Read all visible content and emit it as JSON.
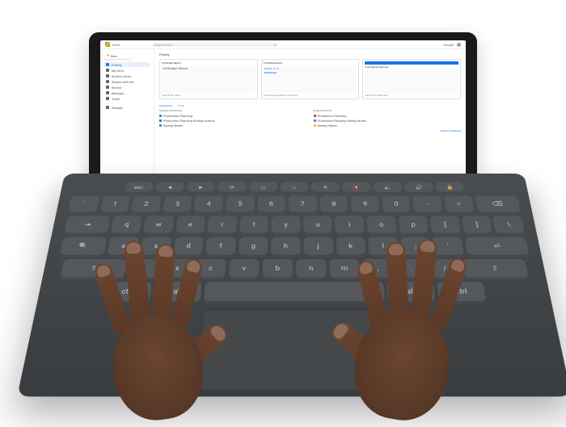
{
  "app": {
    "name": "Drive",
    "brand": "Google"
  },
  "search": {
    "placeholder": "Search Drive"
  },
  "sidebar": {
    "new_label": "New",
    "items": [
      {
        "label": "Priority"
      },
      {
        "label": "My Drive"
      },
      {
        "label": "Shared drives"
      },
      {
        "label": "Shared with me"
      },
      {
        "label": "Recent"
      },
      {
        "label": "Backups"
      },
      {
        "label": "Trash"
      }
    ],
    "storage": "Storage"
  },
  "priority": {
    "heading": "Priority",
    "cards": [
      {
        "title": "Q3 Budget Report",
        "subtitle": "Q3 Budget Report",
        "footer_name": "Laura Pronto",
        "footer_note": "Edited"
      },
      {
        "title": "Q3 Budget Report",
        "subtitle_small": "SLIDES 11-13",
        "subtitle": "Final Decks",
        "footer_note": "Leah Hoegan requested an action item"
      },
      {
        "title": "Volunteering Sign-ups",
        "footer_note": "Alex Simons edited today"
      }
    ]
  },
  "workspaces": {
    "tabs": [
      "Workspaces",
      "Create"
    ],
    "columns": [
      {
        "header": "Anderson-Production",
        "files": [
          {
            "name": "Production Planning",
            "icon": "blue"
          },
          {
            "name": "Production Planning Rolling Actions",
            "icon": "green"
          },
          {
            "name": "Weekly Notes",
            "icon": "blue"
          }
        ]
      },
      {
        "header": "Project Financial",
        "files": [
          {
            "name": "Production Planning",
            "icon": "red"
          },
          {
            "name": "Production Planning Rolling Notes",
            "icon": "blue"
          },
          {
            "name": "Weekly Notes",
            "icon": "yellow"
          }
        ]
      }
    ],
    "more": "Create a workspace"
  },
  "keyboard": {
    "fn_row": [
      "esc",
      "◄",
      "►",
      "⟳",
      "▭",
      "☼",
      "☀",
      "🔇",
      "🔉",
      "🔊",
      "🔒"
    ],
    "row1": [
      "`",
      "1",
      "2",
      "3",
      "4",
      "5",
      "6",
      "7",
      "8",
      "9",
      "0",
      "-",
      "=",
      "⌫"
    ],
    "row2": [
      "⇥",
      "q",
      "w",
      "e",
      "r",
      "t",
      "y",
      "u",
      "i",
      "o",
      "p",
      "[",
      "]",
      "\\"
    ],
    "row3": [
      "🔍",
      "a",
      "s",
      "d",
      "f",
      "g",
      "h",
      "j",
      "k",
      "l",
      ";",
      "'",
      "⏎"
    ],
    "row4": [
      "⇧",
      "z",
      "x",
      "c",
      "v",
      "b",
      "n",
      "m",
      ",",
      ".",
      "/",
      "⇧"
    ],
    "row5": [
      "ctrl",
      "alt",
      " ",
      "alt",
      "ctrl"
    ]
  }
}
